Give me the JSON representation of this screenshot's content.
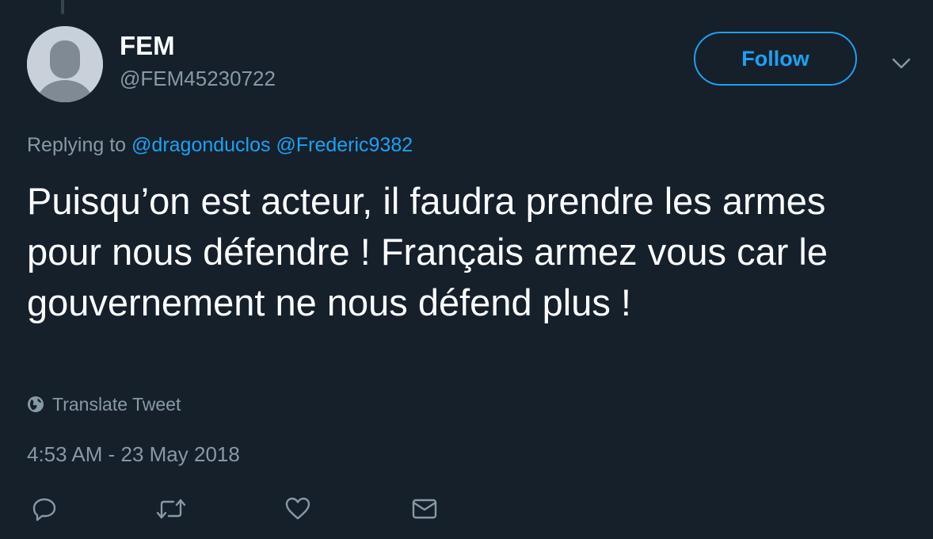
{
  "author": {
    "display_name": "FEM",
    "username": "@FEM45230722",
    "avatar_icon": "default-avatar-icon"
  },
  "follow_button": {
    "label": "Follow"
  },
  "menu": {
    "icon": "chevron-down-icon"
  },
  "reply_context": {
    "prefix": "Replying to",
    "mentions": [
      "@dragonduclos",
      "@Frederic9382"
    ]
  },
  "tweet": {
    "text": "Puisqu’on est acteur, il faudra prendre les armes pour nous défendre ! Français armez vous car le gouvernement ne nous défend plus !",
    "translate_label": "Translate Tweet",
    "timestamp": "4:53 AM - 23 May 2018"
  },
  "actions": [
    {
      "name": "reply",
      "icon": "reply-icon"
    },
    {
      "name": "retweet",
      "icon": "retweet-icon"
    },
    {
      "name": "like",
      "icon": "heart-icon"
    },
    {
      "name": "direct-message",
      "icon": "envelope-icon"
    }
  ],
  "colors": {
    "background": "#15202b",
    "primary_text": "#ffffff",
    "secondary_text": "#8899a6",
    "accent": "#1da1f2",
    "avatar_bg": "#c8d1d9",
    "avatar_fg": "#7f8a94"
  }
}
